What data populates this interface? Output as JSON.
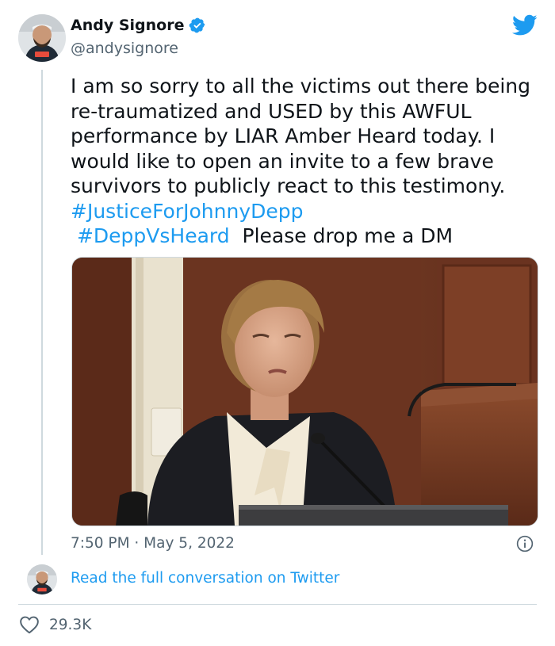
{
  "tweet": {
    "author_name": "Andy Signore",
    "author_handle": "@andysignore",
    "verified": true,
    "text_segments": [
      {
        "text": "I am so sorry to all the victims out there being re-traumatized and USED by this AWFUL performance by LIAR Amber Heard today. I would like to open an invite to a few brave survivors to publicly react to this testimony. ",
        "type": "text"
      },
      {
        "text": "#JusticeForJohnnyDepp",
        "type": "hashtag"
      },
      {
        "text": " ",
        "type": "text"
      },
      {
        "text": "#DeppVsHeard",
        "type": "hashtag"
      },
      {
        "text": "  Please drop me a DM",
        "type": "text"
      }
    ],
    "timestamp": "7:50 PM · May 5, 2022",
    "read_more_label": "Read the full conversation on Twitter",
    "like_count": "29.3K"
  },
  "icons": {
    "brand": "twitter-bird-icon",
    "verified": "verified-badge-icon",
    "info": "info-icon",
    "like": "heart-icon"
  },
  "colors": {
    "accent": "#1d9bf0",
    "text": "#0f1419",
    "secondary_text": "#536471",
    "border": "#cfd9de"
  }
}
